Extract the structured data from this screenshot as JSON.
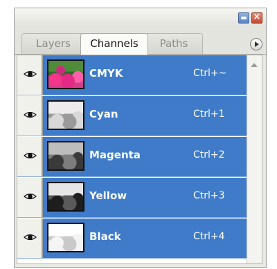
{
  "tabs": [
    "Layers",
    "Channels",
    "Paths"
  ],
  "active_tab": "Channels",
  "channels": [
    {
      "name": "CMYK",
      "shortcut": "Ctrl+~",
      "visible": true,
      "thumbnail": "color"
    },
    {
      "name": "Cyan",
      "shortcut": "Ctrl+1",
      "visible": true,
      "thumbnail": "grayscale"
    },
    {
      "name": "Magenta",
      "shortcut": "Ctrl+2",
      "visible": true,
      "thumbnail": "grayscale"
    },
    {
      "name": "Yellow",
      "shortcut": "Ctrl+3",
      "visible": true,
      "thumbnail": "grayscale"
    },
    {
      "name": "Black",
      "shortcut": "Ctrl+4",
      "visible": true,
      "thumbnail": "grayscale"
    }
  ],
  "icons": {
    "minimize": "minimize-icon",
    "close": "close-icon",
    "panel_menu": "panel-menu-icon",
    "visibility": "eye-icon",
    "scroll_up": "scroll-up-arrow-icon"
  },
  "colors": {
    "selection": "#3f7bc8",
    "panel_bg": "#e9e9e4",
    "minimize_button": "#5a83c4",
    "close_button": "#c14b33"
  }
}
